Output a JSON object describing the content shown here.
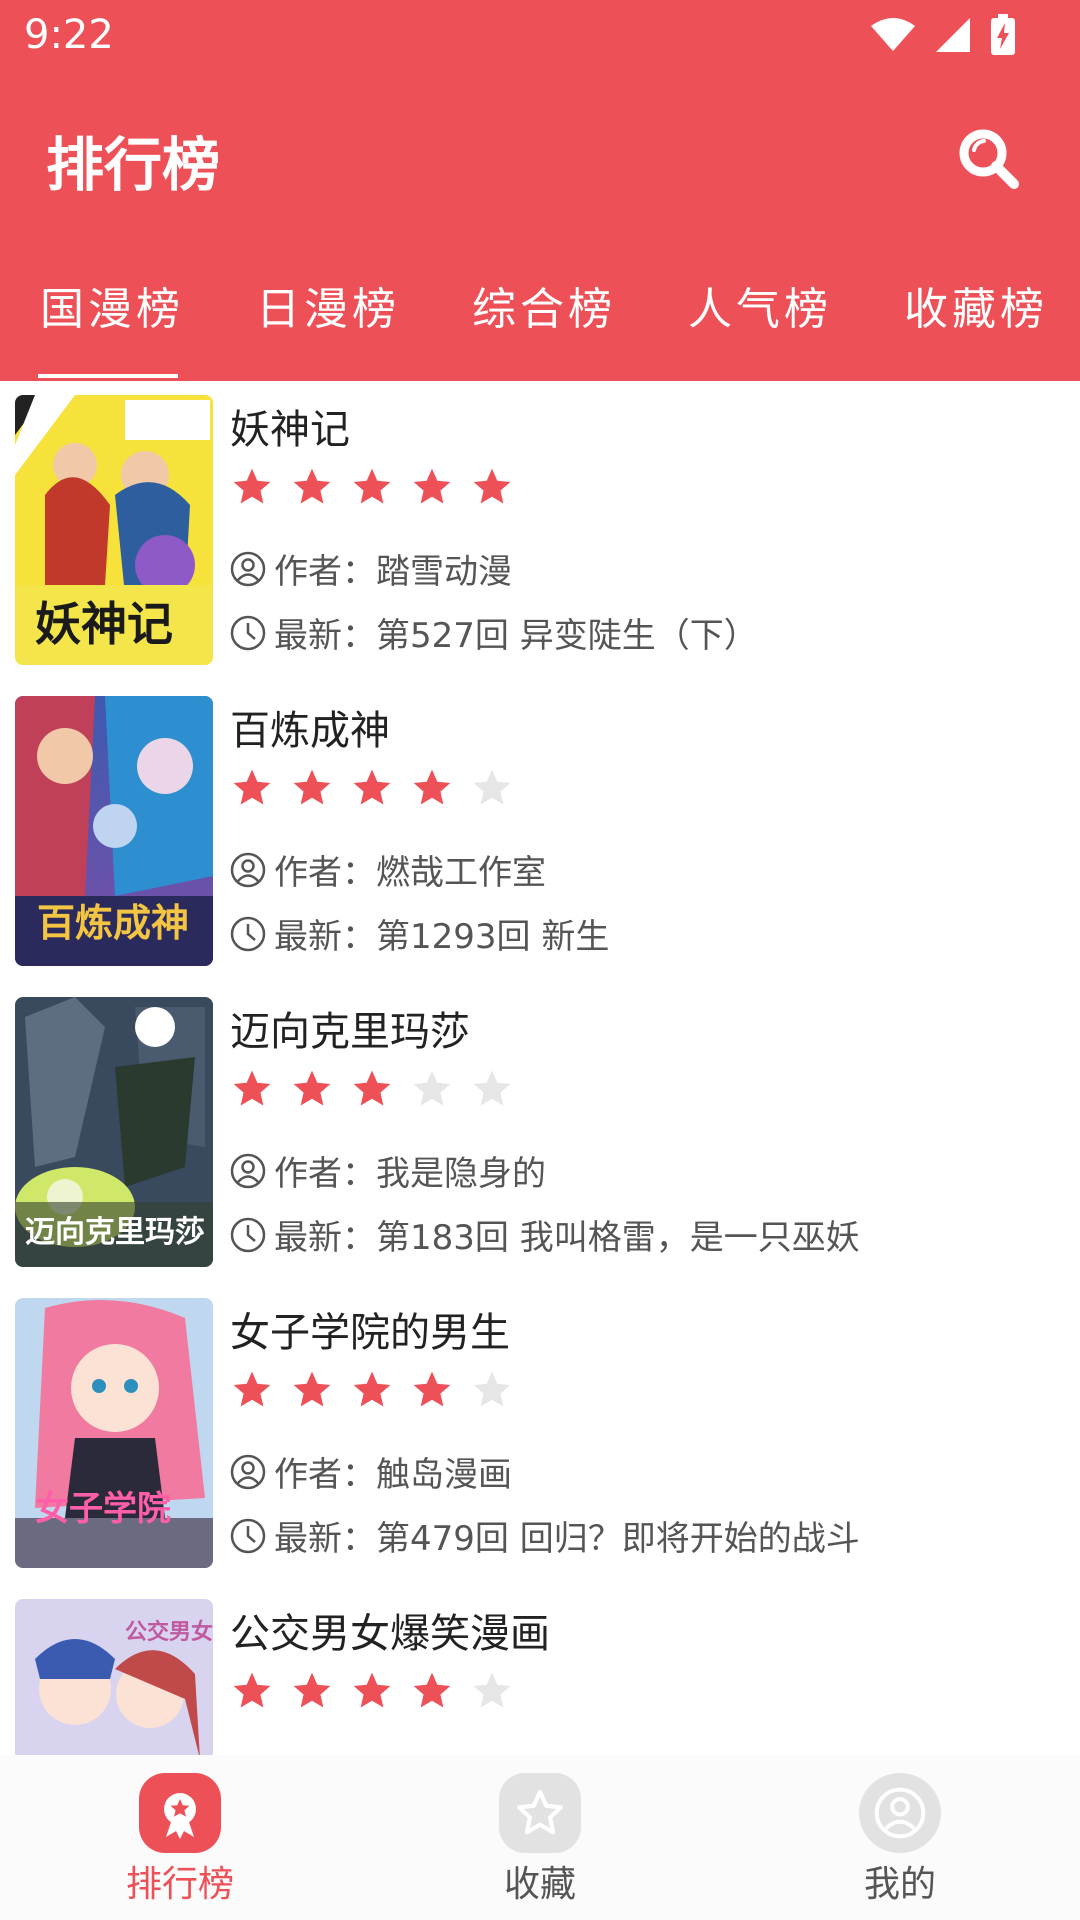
{
  "status_bar": {
    "time": "9:22"
  },
  "header": {
    "title": "排行榜"
  },
  "tabs": [
    {
      "label": "国漫榜",
      "active": true
    },
    {
      "label": "日漫榜",
      "active": false
    },
    {
      "label": "综合榜",
      "active": false
    },
    {
      "label": "人气榜",
      "active": false
    },
    {
      "label": "收藏榜",
      "active": false
    }
  ],
  "colors": {
    "accent": "#EE5057",
    "star_on": "#EE5057",
    "star_off": "#E6E6E6",
    "nav_inactive": "#555555"
  },
  "list": [
    {
      "title": "妖神记",
      "rating": 5,
      "author": "作者：踏雪动漫",
      "latest": "最新：第527回 异变陡生（下）"
    },
    {
      "title": "百炼成神",
      "rating": 4,
      "author": "作者：燃哉工作室",
      "latest": "最新：第1293回 新生"
    },
    {
      "title": "迈向克里玛莎",
      "rating": 3,
      "author": "作者：我是隐身的",
      "latest": "最新：第183回 我叫格雷，是一只巫妖"
    },
    {
      "title": "女子学院的男生",
      "rating": 4,
      "author": "作者：触岛漫画",
      "latest": "最新：第479回 回归？即将开始的战斗"
    },
    {
      "title": "公交男女爆笑漫画",
      "rating": 4,
      "author": "",
      "latest": ""
    }
  ],
  "bottom_nav": [
    {
      "label": "排行榜",
      "icon": "ranking-icon",
      "active": true
    },
    {
      "label": "收藏",
      "icon": "star-icon",
      "active": false
    },
    {
      "label": "我的",
      "icon": "user-icon",
      "active": false
    }
  ]
}
